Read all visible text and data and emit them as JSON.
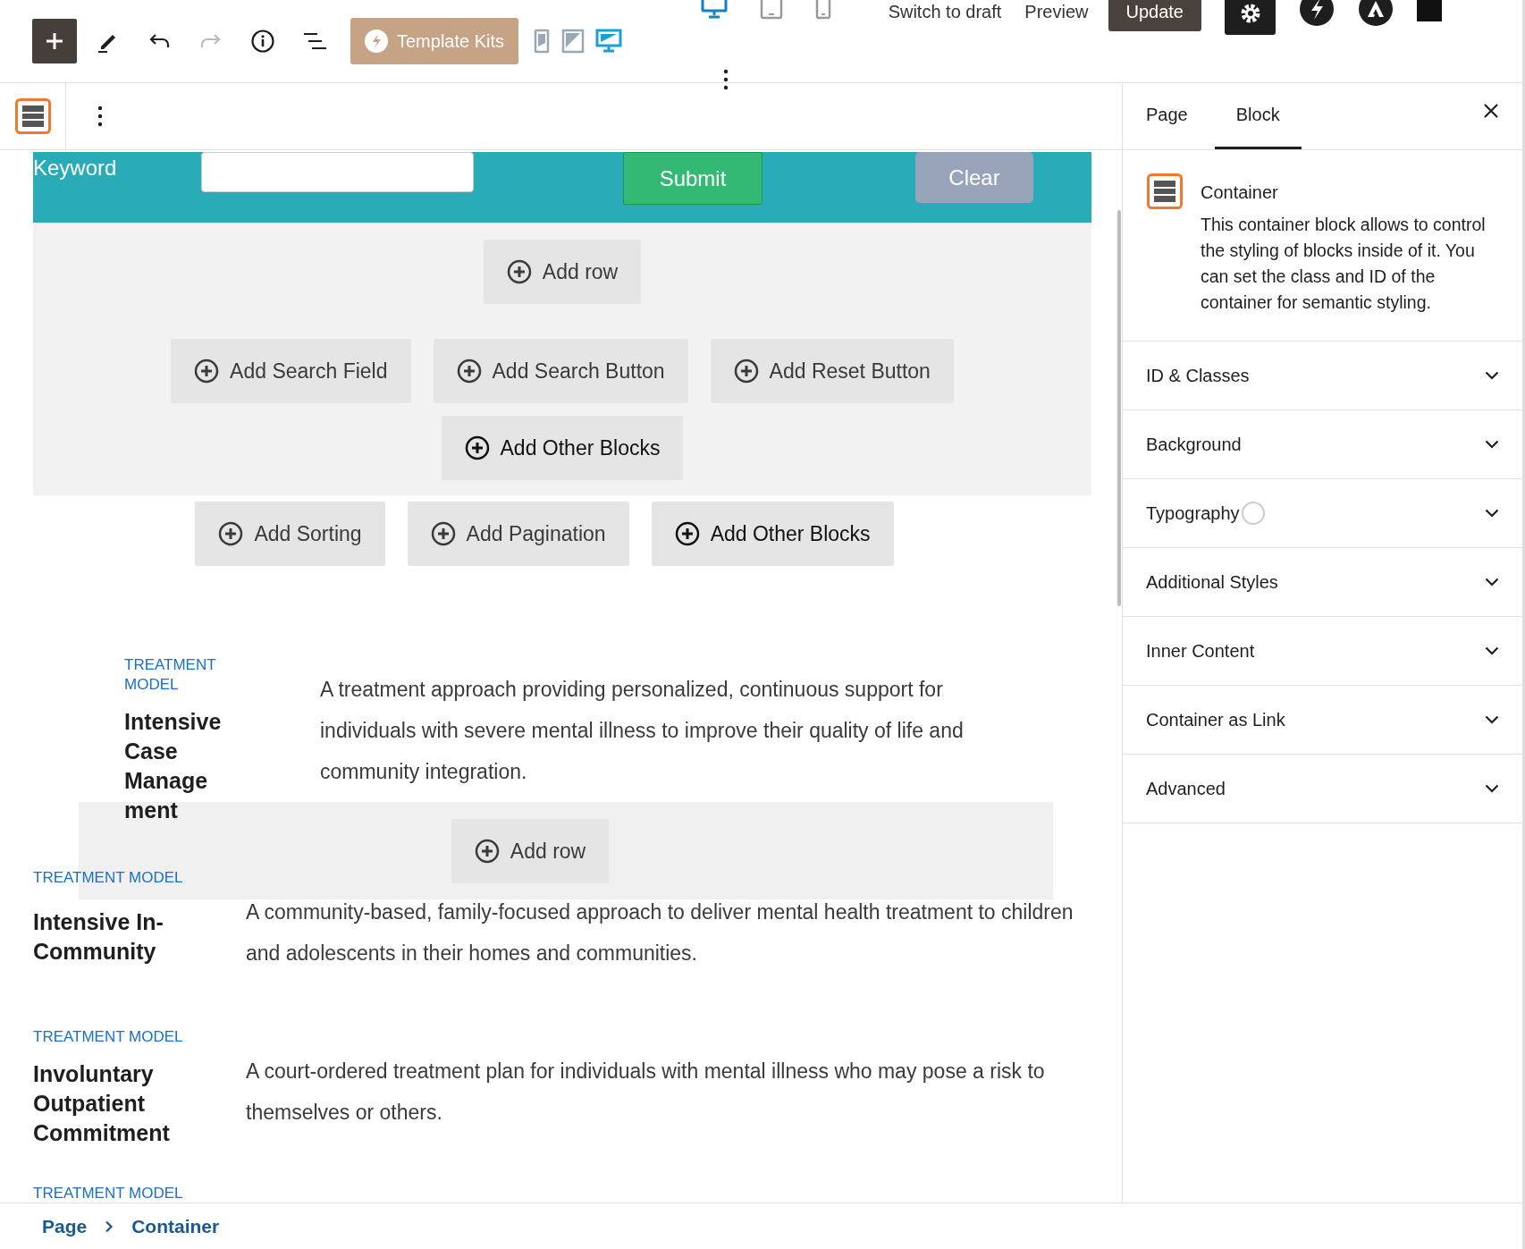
{
  "top_bar": {
    "tools": [
      {
        "kind": "add",
        "disabled": false
      },
      {
        "kind": "edit",
        "disabled": false
      },
      {
        "kind": "undo",
        "disabled": false
      },
      {
        "kind": "redo",
        "disabled": true
      },
      {
        "kind": "info",
        "disabled": false
      },
      {
        "kind": "list",
        "disabled": false
      }
    ],
    "template_kits": "Template Kits",
    "view_modes": [
      {
        "kind": "mobile",
        "selected": false
      },
      {
        "kind": "tablet",
        "selected": false
      },
      {
        "kind": "desktop",
        "selected": true
      }
    ],
    "preview_devices": [
      {
        "kind": "desktop",
        "selected": true
      },
      {
        "kind": "tablet",
        "selected": false
      },
      {
        "kind": "mobile",
        "selected": false
      }
    ],
    "switch_to_draft": "Switch to draft",
    "preview": "Preview",
    "update": "Update",
    "extras": [
      {
        "kind": "settings"
      },
      {
        "kind": "bolt"
      },
      {
        "kind": "peak"
      },
      {
        "kind": "square"
      }
    ]
  },
  "search_form": {
    "label": "Keyword",
    "submit": "Submit",
    "clear": "Clear"
  },
  "inner_appenders": [
    [
      {
        "label": "Add row"
      }
    ],
    [
      {
        "label": "Add Search Field"
      },
      {
        "label": "Add Search Button"
      },
      {
        "label": "Add Reset Button"
      }
    ],
    [
      {
        "label": "Add Other Blocks"
      }
    ]
  ],
  "outer_appenders": [
    {
      "label": "Add Sorting"
    },
    {
      "label": "Add Pagination"
    },
    {
      "label": "Add Other Blocks"
    }
  ],
  "items": [
    {
      "kind": "indented",
      "category": "TREATMENT MODEL",
      "title": "Intensive Case Management",
      "description": "A treatment approach providing personalized, continuous support for individuals with severe mental illness to improve their quality of life and community integration."
    },
    {
      "kind": "flush",
      "category": "TREATMENT MODEL",
      "title": "Intensive In-Community",
      "description": "A community-based, family-focused approach to deliver mental health treatment to children and adolescents in their homes and communities."
    },
    {
      "kind": "flush",
      "category": "TREATMENT MODEL",
      "title": "Involuntary Outpatient Commitment",
      "description": "A court-ordered treatment plan for individuals with mental illness who may pose a risk to themselves or others."
    },
    {
      "kind": "flush",
      "category": "TREATMENT MODEL"
    }
  ],
  "row_appender": {
    "label": "Add row"
  },
  "sidebar": {
    "tabs": [
      {
        "label": "Page",
        "selected": false
      },
      {
        "label": "Block",
        "selected": true
      }
    ],
    "block": {
      "name": "Container",
      "description": "This container block allows to control the styling of blocks inside of it. You can set the class and ID of the container for semantic styling."
    },
    "panels": [
      {
        "label": "ID & Classes",
        "expanded": false,
        "indicator": false
      },
      {
        "label": "Background",
        "expanded": false,
        "indicator": false
      },
      {
        "label": "Typography",
        "expanded": false,
        "indicator": true
      },
      {
        "label": "Additional Styles",
        "expanded": false,
        "indicator": false
      },
      {
        "label": "Inner Content",
        "expanded": false,
        "indicator": false
      },
      {
        "label": "Container as Link",
        "expanded": false,
        "indicator": false
      },
      {
        "label": "Advanced",
        "expanded": false,
        "indicator": false
      }
    ]
  },
  "breadcrumb": [
    "Page",
    "Container"
  ]
}
